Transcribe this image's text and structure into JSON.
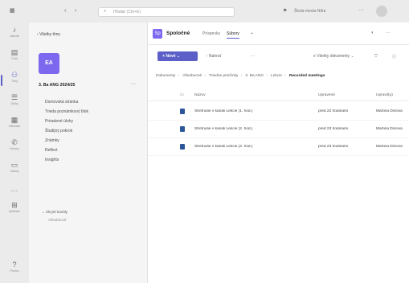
{
  "topbar": {
    "search_placeholder": "Hľadať (Ctrl+E)",
    "org_label": "Škola mesta Nitra",
    "more_icon": "more-dots-icon"
  },
  "rail": [
    {
      "label": "Aktivita",
      "icon": "bell-icon"
    },
    {
      "label": "Chat",
      "icon": "chat-icon"
    },
    {
      "label": "Tímy",
      "icon": "teams-icon"
    },
    {
      "label": "Úlohy",
      "icon": "assignments-icon"
    },
    {
      "label": "Kalendár",
      "icon": "calendar-icon"
    },
    {
      "label": "Hovory",
      "icon": "phone-icon"
    },
    {
      "label": "Súbory",
      "icon": "files-icon"
    },
    {
      "label": "Aplikácie",
      "icon": "apps-icon"
    },
    {
      "label": "Pomoc",
      "icon": "help-icon"
    }
  ],
  "panel": {
    "back_label": "Všetky tímy",
    "team_initials": "EA",
    "team_name": "3. Ba ANG 2024/25",
    "nav": [
      "Domovská stránka",
      "Trieda poznámkový blok",
      "Priradené úlohy",
      "Študijný pokrok",
      "Známky",
      "Reflect",
      "Insights"
    ],
    "hidden_channel": "Skryté kanály",
    "hidden_sub": "Všeobecné"
  },
  "main": {
    "channel_initials": "Sp",
    "channel_title": "Spoločné",
    "tabs": [
      "Príspevky",
      "Súbory"
    ],
    "tabs_more": "+",
    "new_label": "Nové",
    "upload_label": "Nahrať",
    "toolbar_more": "···",
    "view_label": "Všetky dokumenty",
    "crumbs": [
      "Dokumenty",
      "Všeobecné",
      "Triedne priečinky",
      "3. Ba ANG",
      "Lekcie"
    ],
    "crumb_current": "Recorded meetings",
    "columns": {
      "name": "Názov",
      "modified": "Upravené",
      "by": "Upravil(a)"
    },
    "files": [
      {
        "name": "Stretnutie v kanáli Lekcie (1. hod.)",
        "modified": "pred 22 hodinami",
        "by": "Martina Dorová"
      },
      {
        "name": "Stretnutie v kanáli Lekcie (2. hod.)",
        "modified": "pred 23 hodinami",
        "by": "Martina Dorová"
      },
      {
        "name": "Stretnutie v kanáli Lekcie (3. hod.)",
        "modified": "pred 23 hodinami",
        "by": "Martina Dorová"
      }
    ]
  }
}
